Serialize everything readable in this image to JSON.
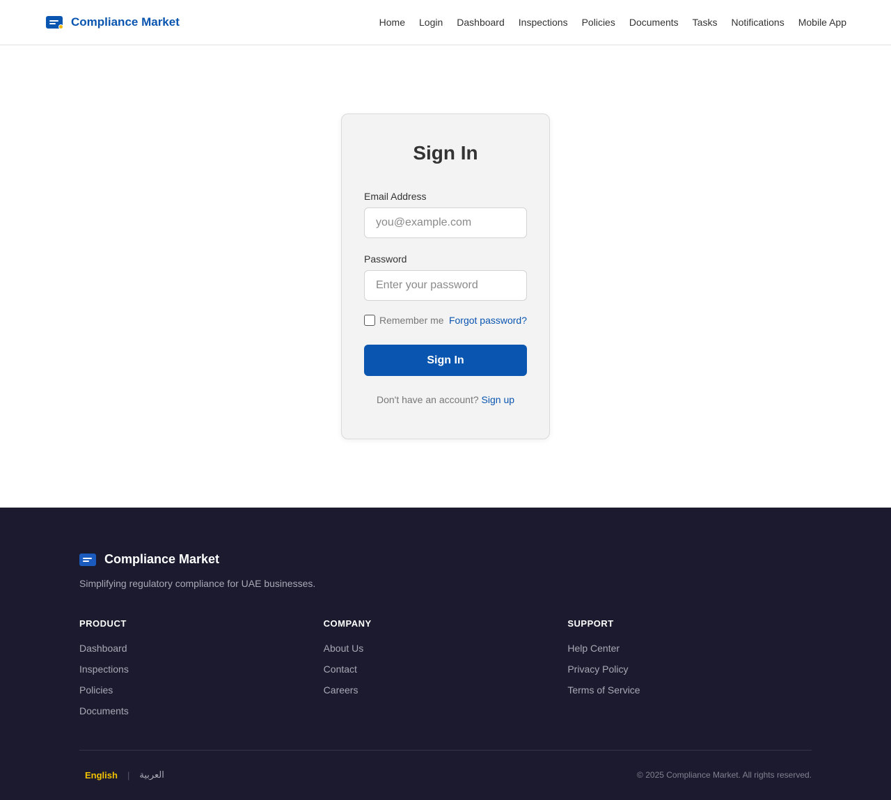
{
  "header": {
    "brand": "Compliance Market",
    "nav": [
      "Home",
      "Login",
      "Dashboard",
      "Inspections",
      "Policies",
      "Documents",
      "Tasks",
      "Notifications",
      "Mobile App"
    ]
  },
  "signin": {
    "title": "Sign In",
    "email_label": "Email Address",
    "email_placeholder": "you@example.com",
    "email_value": "",
    "password_label": "Password",
    "password_placeholder": "Enter your password",
    "password_value": "",
    "remember_label": "Remember me",
    "remember_checked": false,
    "forgot_label": "Forgot password?",
    "submit_label": "Sign In",
    "no_account_text": "Don't have an account?",
    "signup_label": "Sign up"
  },
  "footer": {
    "brand": "Compliance Market",
    "tagline": "Simplifying regulatory compliance for UAE businesses.",
    "columns": [
      {
        "title": "PRODUCT",
        "links": [
          "Dashboard",
          "Inspections",
          "Policies",
          "Documents"
        ]
      },
      {
        "title": "COMPANY",
        "links": [
          "About Us",
          "Contact",
          "Careers"
        ]
      },
      {
        "title": "SUPPORT",
        "links": [
          "Help Center",
          "Privacy Policy",
          "Terms of Service"
        ]
      }
    ],
    "languages": {
      "active": "English",
      "separator": "|",
      "other": "العربية"
    },
    "copyright": "© 2025 Compliance Market. All rights reserved."
  },
  "colors": {
    "brand_blue": "#0a55b0",
    "footer_bg": "#1b1a2e",
    "accent_yellow": "#f2c200"
  },
  "icons": {
    "brand_logo": "document-badge-icon",
    "footer_logo": "document-icon"
  }
}
